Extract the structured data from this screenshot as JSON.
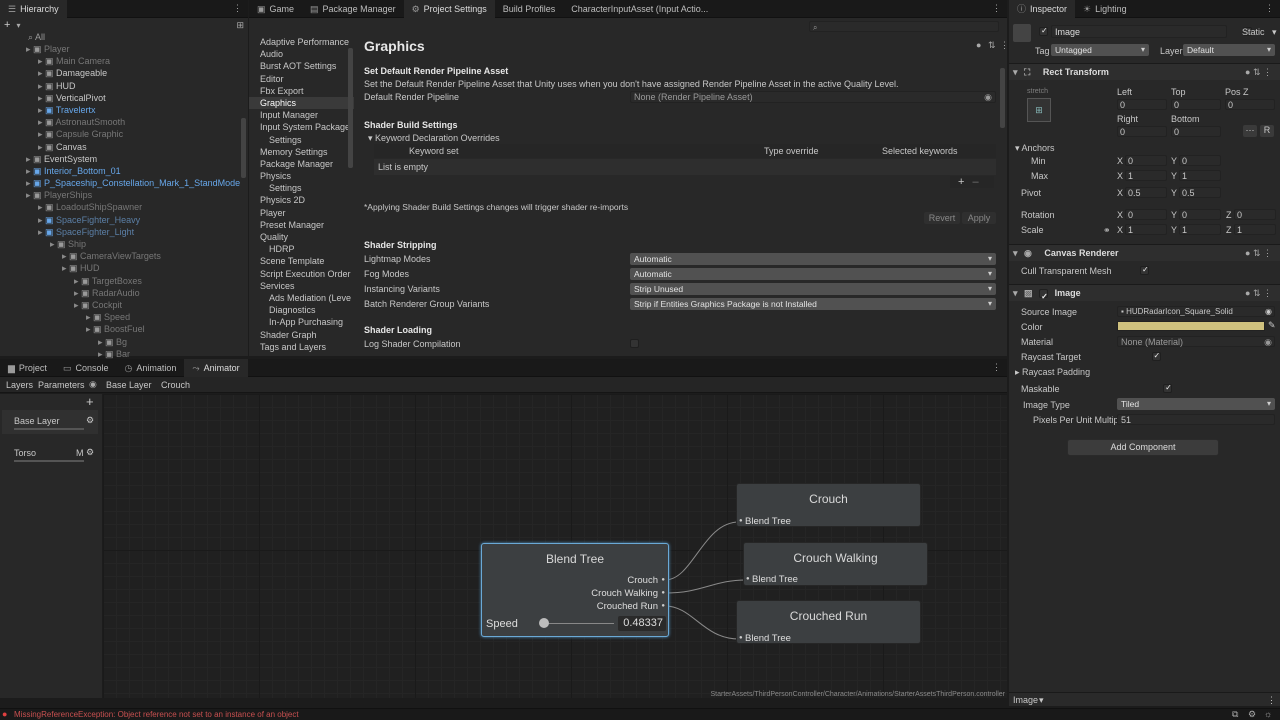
{
  "hierarchy": {
    "tab_label": "Hierarchy",
    "search_placeholder": "All",
    "items": [
      {
        "label": "Player",
        "indent": 1,
        "style": "dim"
      },
      {
        "label": "Main Camera",
        "indent": 2,
        "style": "dim"
      },
      {
        "label": "Damageable",
        "indent": 2,
        "style": "normal"
      },
      {
        "label": "HUD",
        "indent": 2,
        "style": "normal"
      },
      {
        "label": "VerticalPivot",
        "indent": 2,
        "style": "normal"
      },
      {
        "label": "Travelertx",
        "indent": 2,
        "style": "blue"
      },
      {
        "label": "AstronautSmooth",
        "indent": 2,
        "style": "dim"
      },
      {
        "label": "Capsule Graphic",
        "indent": 2,
        "style": "dim"
      },
      {
        "label": "Canvas",
        "indent": 2,
        "style": "normal"
      },
      {
        "label": "EventSystem",
        "indent": 1,
        "style": "normal"
      },
      {
        "label": "Interior_Bottom_01",
        "indent": 1,
        "style": "blue"
      },
      {
        "label": "P_Spaceship_Constellation_Mark_1_StandMode",
        "indent": 1,
        "style": "blue"
      },
      {
        "label": "PlayerShips",
        "indent": 1,
        "style": "dim"
      },
      {
        "label": "LoadoutShipSpawner",
        "indent": 2,
        "style": "dim"
      },
      {
        "label": "SpaceFighter_Heavy",
        "indent": 2,
        "style": "dimblue"
      },
      {
        "label": "SpaceFighter_Light",
        "indent": 2,
        "style": "dimblue"
      },
      {
        "label": "Ship",
        "indent": 3,
        "style": "dim"
      },
      {
        "label": "CameraViewTargets",
        "indent": 4,
        "style": "dim"
      },
      {
        "label": "HUD",
        "indent": 4,
        "style": "dim"
      },
      {
        "label": "TargetBoxes",
        "indent": 5,
        "style": "dim"
      },
      {
        "label": "RadarAudio",
        "indent": 5,
        "style": "dim"
      },
      {
        "label": "Cockpit",
        "indent": 5,
        "style": "dim"
      },
      {
        "label": "Speed",
        "indent": 6,
        "style": "dim"
      },
      {
        "label": "BoostFuel",
        "indent": 6,
        "style": "dim"
      },
      {
        "label": "Bg",
        "indent": 7,
        "style": "dim"
      },
      {
        "label": "Bar",
        "indent": 7,
        "style": "dim"
      },
      {
        "label": "Image",
        "indent": 8,
        "style": "dim"
      }
    ]
  },
  "center_tabs": [
    "Game",
    "Package Manager",
    "Project Settings",
    "Build Profiles",
    "CharacterInputAsset (Input Actio..."
  ],
  "settings_nav": [
    "Adaptive Performance",
    "Audio",
    "Burst AOT Settings",
    "Editor",
    "Fbx Export",
    "Graphics",
    "Input Manager",
    "Input System Package",
    "Settings",
    "Memory Settings",
    "Package Manager",
    "Physics",
    "Settings",
    "Physics 2D",
    "Player",
    "Preset Manager",
    "Quality",
    "HDRP",
    "Scene Template",
    "Script Execution Order",
    "Services",
    "Ads Mediation (Leve",
    "Diagnostics",
    "In-App Purchasing",
    "Shader Graph",
    "Tags and Layers"
  ],
  "graphics": {
    "title": "Graphics",
    "rp_header": "Set Default Render Pipeline Asset",
    "rp_desc": "Set the Default Render Pipeline Asset that Unity uses when you don't have assigned Render Pipeline Asset in the active Quality Level.",
    "rp_label": "Default Render Pipeline",
    "rp_value": "None (Render Pipeline Asset)",
    "build_header": "Shader Build Settings",
    "keyword_foldout": "Keyword Declaration Overrides",
    "col_keyword": "Keyword set",
    "col_type": "Type override",
    "col_selected": "Selected keywords",
    "list_empty": "List is empty",
    "apply_note": "*Applying Shader Build Settings changes will trigger shader re-imports",
    "revert": "Revert",
    "apply": "Apply",
    "stripping_header": "Shader Stripping",
    "strip_rows": [
      {
        "label": "Lightmap Modes",
        "value": "Automatic"
      },
      {
        "label": "Fog Modes",
        "value": "Automatic"
      },
      {
        "label": "Instancing Variants",
        "value": "Strip Unused"
      },
      {
        "label": "Batch Renderer Group Variants",
        "value": "Strip if Entities Graphics Package is not Installed"
      }
    ],
    "loading_header": "Shader Loading",
    "log_compilation": "Log Shader Compilation"
  },
  "bottom_tabs": [
    "Project",
    "Console",
    "Animation",
    "Animator"
  ],
  "animator": {
    "layers_tab": "Layers",
    "params_tab": "Parameters",
    "breadcrumb": [
      "Base Layer",
      "Crouch"
    ],
    "layers": [
      {
        "name": "Base Layer",
        "badge": ""
      },
      {
        "name": "Torso",
        "badge": "M"
      }
    ],
    "blend_tree": {
      "title": "Blend Tree",
      "outputs": [
        "Crouch",
        "Crouch Walking",
        "Crouched Run"
      ],
      "param": "Speed",
      "value": "0.48337",
      "slider_fraction": 0.05
    },
    "nodes": [
      {
        "title": "Crouch",
        "port": "Blend Tree"
      },
      {
        "title": "Crouch Walking",
        "port": "Blend Tree"
      },
      {
        "title": "Crouched Run",
        "port": "Blend Tree"
      }
    ],
    "path": "StarterAssets/ThirdPersonController/Character/Animations/StarterAssetsThirdPerson.controller"
  },
  "inspector": {
    "tab": "Inspector",
    "tab2": "Lighting",
    "object_name": "Image",
    "static": "Static",
    "tag_label": "Tag",
    "tag_value": "Untagged",
    "layer_label": "Layer",
    "layer_value": "Default",
    "rect_transform": "Rect Transform",
    "stretch": "stretch",
    "left": "Left",
    "top": "Top",
    "posz": "Pos Z",
    "right": "Right",
    "bottom": "Bottom",
    "zero": "0",
    "one": "1",
    "half": "0.5",
    "x": "X",
    "y": "Y",
    "z": "Z",
    "anchors": "Anchors",
    "min": "Min",
    "max": "Max",
    "pivot": "Pivot",
    "rotation": "Rotation",
    "scale": "Scale",
    "r_button": "R",
    "canvas_renderer": "Canvas Renderer",
    "cull": "Cull Transparent Mesh",
    "image_comp": "Image",
    "source_image": "Source Image",
    "source_value": "HUDRadarIcon_Square_Solid",
    "color": "Color",
    "color_hex": "#cfc17e",
    "material": "Material",
    "material_value": "None (Material)",
    "raycast_target": "Raycast Target",
    "raycast_padding": "Raycast Padding",
    "maskable": "Maskable",
    "image_type": "Image Type",
    "image_type_value": "Tiled",
    "ppu": "Pixels Per Unit Multipli",
    "ppu_value": "51",
    "add_component": "Add Component",
    "footer": "Image"
  },
  "status": {
    "message": "MissingReferenceException: Object reference not set to an instance of an object"
  }
}
